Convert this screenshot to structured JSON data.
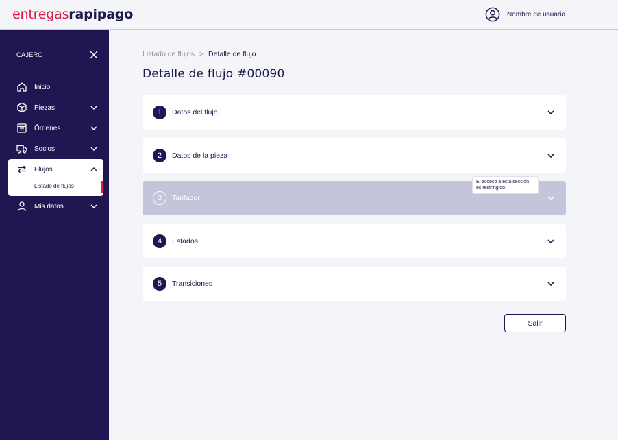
{
  "brand": {
    "part1": "entregas",
    "part2": "rapipago"
  },
  "header": {
    "user_name": "Nombre de usuario"
  },
  "sidebar": {
    "role": "CAJERO",
    "items": [
      {
        "label": "Inicio",
        "icon": "home-icon"
      },
      {
        "label": "Piezas",
        "icon": "box-icon"
      },
      {
        "label": "Órdenes",
        "icon": "orders-icon"
      },
      {
        "label": "Socios",
        "icon": "truck-icon"
      },
      {
        "label": "Flujos",
        "icon": "flows-icon",
        "active": true,
        "sub": [
          "Listado de flujos"
        ]
      },
      {
        "label": "Mis datos",
        "icon": "user-icon"
      }
    ]
  },
  "breadcrumb": {
    "parent": "Listado de flujos",
    "separator": ">",
    "current": "Detalle de flujo"
  },
  "page": {
    "title": "Detalle de flujo #00090"
  },
  "sections": [
    {
      "number": "1",
      "label": "Datos del flujo",
      "disabled": false
    },
    {
      "number": "2",
      "label": "Datos de la pieza",
      "disabled": false
    },
    {
      "number": "3",
      "label": "Tarifador",
      "disabled": true
    },
    {
      "number": "4",
      "label": "Estados",
      "disabled": false
    },
    {
      "number": "5",
      "label": "Transiciones",
      "disabled": false
    }
  ],
  "tooltip": {
    "text": "El acceso a esta sección es restringido."
  },
  "actions": {
    "exit_label": "Salir"
  },
  "colors": {
    "primary": "#221652",
    "accent": "#e21b4d",
    "disabled_panel": "#c4c4da"
  }
}
